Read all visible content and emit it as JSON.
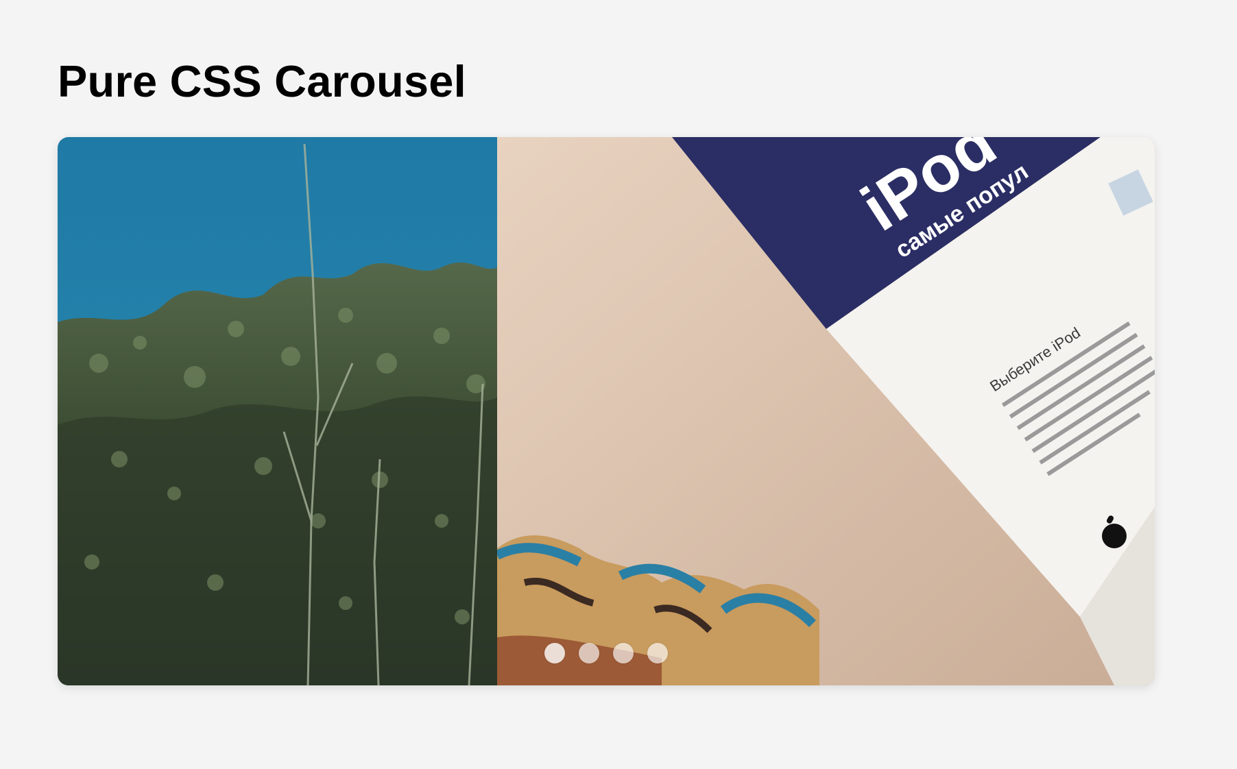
{
  "page": {
    "title": "Pure CSS Carousel"
  },
  "carousel": {
    "slide_count": 4,
    "active_index": 0,
    "dot_color": "#ffffff",
    "slides": [
      {
        "label": "slide-1"
      },
      {
        "label": "slide-2"
      },
      {
        "label": "slide-3"
      },
      {
        "label": "slide-4"
      }
    ],
    "box_text": {
      "brand": "iPod",
      "tagline": "самые попул",
      "heading": "Выберите iPod"
    }
  },
  "colors": {
    "background": "#f4f4f4",
    "sky": "#1f7fa8",
    "foliage": "#3c4f2e",
    "box_navy": "#2b2e64",
    "wall": "#dcc3ac"
  }
}
